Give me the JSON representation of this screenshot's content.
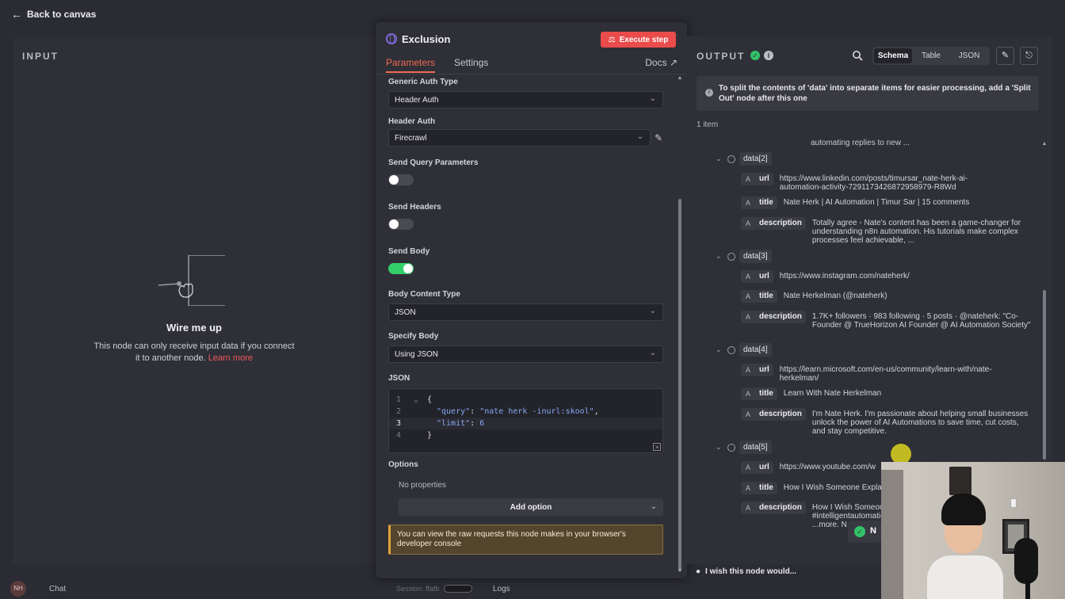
{
  "topbar": {
    "back_label": "Back to canvas"
  },
  "input": {
    "label": "INPUT",
    "empty_title": "Wire me up",
    "empty_text": "This node can only receive input data if you connect it to another node.",
    "learn_more": "Learn more"
  },
  "node": {
    "title": "Exclusion",
    "execute_label": "Execute step",
    "tabs": [
      {
        "label": "Parameters",
        "active": true
      },
      {
        "label": "Settings",
        "active": false
      }
    ],
    "docs_label": "Docs",
    "fields": {
      "generic_auth_label": "Generic Auth Type",
      "generic_auth_value": "Header Auth",
      "header_auth_label": "Header Auth",
      "header_auth_value": "Firecrawl",
      "send_query_label": "Send Query Parameters",
      "send_query_on": false,
      "send_headers_label": "Send Headers",
      "send_headers_on": false,
      "send_body_label": "Send Body",
      "send_body_on": true,
      "body_content_type_label": "Body Content Type",
      "body_content_type_value": "JSON",
      "specify_body_label": "Specify Body",
      "specify_body_value": "Using JSON",
      "json_label": "JSON"
    },
    "json_code": {
      "line_numbers": [
        "1",
        "2",
        "3",
        "4"
      ],
      "open_brace": "{",
      "query_key": "\"query\"",
      "query_value": "\"nate herk -inurl:skool\"",
      "limit_key": "\"limit\"",
      "limit_value": "6",
      "close_brace": "}"
    },
    "options_label": "Options",
    "no_properties": "No properties",
    "add_option": "Add option",
    "notice": "You can view the raw requests this node makes in your browser's developer console"
  },
  "output": {
    "label": "OUTPUT",
    "views": [
      {
        "label": "Schema",
        "active": true
      },
      {
        "label": "Table",
        "active": false
      },
      {
        "label": "JSON",
        "active": false
      }
    ],
    "tip": "To split the contents of 'data' into separate items for easier processing, add a 'Split Out' node after this one",
    "items_count": "1 item",
    "truncated_text": "automating replies to new ...",
    "type_marker": "A",
    "groups": [
      {
        "key": "data[2]",
        "rows": [
          {
            "key": "url",
            "value": "https://www.linkedin.com/posts/timursar_nate-herk-ai-automation-activity-7291173426872958979-R8Wd"
          },
          {
            "key": "title",
            "value": "Nate Herk | AI Automation | Timur Sar | 15 comments"
          },
          {
            "key": "description",
            "value": "Totally agree - Nate's content has been a game-changer for understanding n8n automation. His tutorials make complex processes feel achievable, ..."
          }
        ]
      },
      {
        "key": "data[3]",
        "rows": [
          {
            "key": "url",
            "value": "https://www.instagram.com/nateherk/"
          },
          {
            "key": "title",
            "value": "Nate Herkelman (@nateherk)"
          },
          {
            "key": "description",
            "value": "1.7K+ followers · 983 following · 5 posts · @nateherk: \"Co-Founder @ TrueHorizon AI Founder @ AI Automation Society\""
          }
        ]
      },
      {
        "key": "data[4]",
        "rows": [
          {
            "key": "url",
            "value": "https://learn.microsoft.com/en-us/community/learn-with/nate-herkelman/"
          },
          {
            "key": "title",
            "value": "Learn With Nate Herkelman"
          },
          {
            "key": "description",
            "value": "I'm Nate Herk. I'm passionate about helping small businesses unlock the power of AI Automations to save time, cut costs, and stay competitive."
          }
        ]
      },
      {
        "key": "data[5]",
        "rows": [
          {
            "key": "url",
            "value": "https://www.youtube.com/w"
          },
          {
            "key": "title",
            "value": "How I Wish Someone Expla"
          },
          {
            "key": "description",
            "value": "How I Wish Someon #intelligentautomation ...more. N"
          }
        ]
      }
    ],
    "wish_label": "I wish this node would..."
  },
  "bottombar": {
    "avatar_initials": "NH",
    "chat_label": "Chat",
    "session_label": "Session: ffafb",
    "logs_label": "Logs"
  },
  "toast_letter": "N",
  "colors": {
    "accent": "#f06a4f",
    "execute": "#ea4b4b",
    "success": "#33c26a",
    "toggle_on": "#33d06a"
  }
}
